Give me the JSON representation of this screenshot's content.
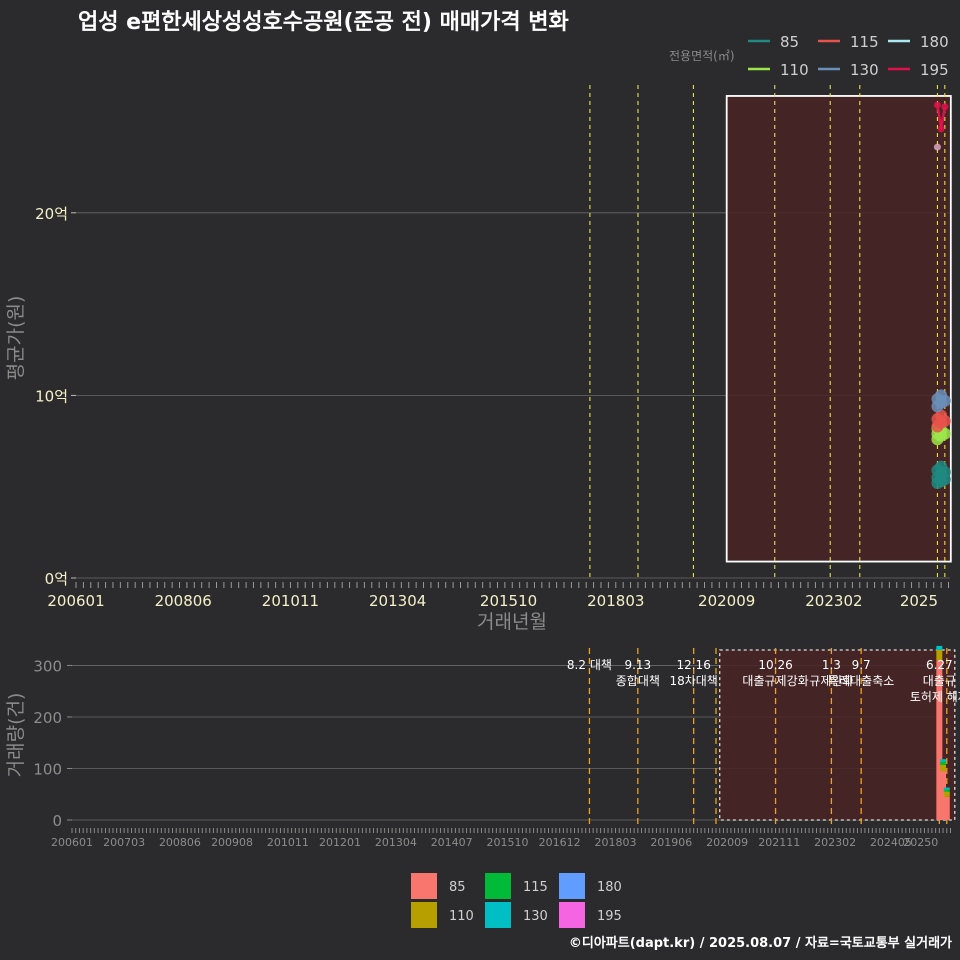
{
  "title": "업성 e편한세상성성호수공원(준공 전) 매매가격 변화",
  "footer": "©디아파트(dapt.kr) / 2025.08.07 / 자료=국토교통부 실거래가",
  "colors": {
    "background": "#2b2b2d",
    "grid": "#6a6a6a",
    "highlight_fill": "#4a2325",
    "policy_line_top": "#e8e04a",
    "policy_line_bottom": "#f0a020"
  },
  "chart_data": [
    {
      "type": "scatter",
      "title": "업성 e편한세상성성호수공원(준공 전) 매매가격 변화",
      "xlabel": "거래년월",
      "ylabel": "평균가(원)",
      "ylim": [
        0,
        27
      ],
      "y_ticks": [
        0,
        10,
        20
      ],
      "y_tick_labels": [
        "0억",
        "10억",
        "20억"
      ],
      "x_ticks": [
        "200601",
        "200806",
        "201011",
        "201304",
        "201510",
        "201803",
        "202009",
        "202302",
        "2025"
      ],
      "grid": true,
      "legend_title": "전용면적(㎡)",
      "legend_position": "top-right",
      "legend": [
        {
          "name": "85",
          "color": "#1f8a80"
        },
        {
          "name": "110",
          "color": "#9ce64a"
        },
        {
          "name": "115",
          "color": "#e8524a"
        },
        {
          "name": "130",
          "color": "#6a8fb8"
        },
        {
          "name": "180",
          "color": "#a8eaf0"
        },
        {
          "name": "195",
          "color": "#e0104a"
        }
      ],
      "policy_dates": [
        "2017-08",
        "2018-09",
        "2019-12",
        "2021-10",
        "2023-01",
        "2023-09",
        "2025-06",
        "2025-08"
      ],
      "highlight_range": {
        "x": [
          "2020-09",
          "2025-08"
        ],
        "y": [
          0.9,
          26.4
        ]
      },
      "series": [
        {
          "name": "85",
          "points": [
            [
              "2025-06",
              5.2
            ],
            [
              "2025-06",
              5.5
            ],
            [
              "2025-06",
              5.9
            ],
            [
              "2025-07",
              5.3
            ],
            [
              "2025-07",
              5.7
            ],
            [
              "2025-07",
              6.1
            ],
            [
              "2025-08",
              5.4
            ],
            [
              "2025-08",
              5.8
            ]
          ]
        },
        {
          "name": "110",
          "points": [
            [
              "2025-06",
              7.6
            ],
            [
              "2025-06",
              7.9
            ],
            [
              "2025-06",
              8.2
            ],
            [
              "2025-07",
              7.8
            ],
            [
              "2025-07",
              8.1
            ],
            [
              "2025-08",
              7.9
            ]
          ]
        },
        {
          "name": "115",
          "points": [
            [
              "2025-06",
              8.3
            ],
            [
              "2025-06",
              8.7
            ],
            [
              "2025-07",
              8.5
            ],
            [
              "2025-07",
              8.9
            ],
            [
              "2025-08",
              8.6
            ]
          ]
        },
        {
          "name": "130",
          "points": [
            [
              "2025-06",
              9.4
            ],
            [
              "2025-06",
              9.8
            ],
            [
              "2025-07",
              9.6
            ],
            [
              "2025-07",
              10.0
            ],
            [
              "2025-08",
              9.7
            ]
          ]
        },
        {
          "name": "195",
          "points": [
            [
              "2025-06",
              25.9
            ],
            [
              "2025-07",
              24.6
            ],
            [
              "2025-08",
              25.8
            ]
          ]
        },
        {
          "name": "180",
          "points": [
            [
              "2025-06",
              23.6
            ]
          ]
        }
      ]
    },
    {
      "type": "bar",
      "ylabel": "거래량(건)",
      "ylim": [
        0,
        330
      ],
      "y_ticks": [
        0,
        100,
        200,
        300
      ],
      "x_ticks": [
        "200601",
        "200703",
        "200806",
        "200908",
        "201011",
        "201201",
        "201304",
        "201407",
        "201510",
        "201612",
        "201803",
        "201906",
        "202009",
        "202111",
        "202302",
        "202405",
        "20250"
      ],
      "grid": true,
      "legend_position": "bottom",
      "legend": [
        {
          "name": "85",
          "color": "#f8766d"
        },
        {
          "name": "110",
          "color": "#b79f00"
        },
        {
          "name": "115",
          "color": "#00ba38"
        },
        {
          "name": "130",
          "color": "#00bfc4"
        },
        {
          "name": "180",
          "color": "#619cff"
        },
        {
          "name": "195",
          "color": "#f564e3"
        }
      ],
      "highlight_range": {
        "x": [
          "2020-07",
          "2025-08"
        ],
        "y": [
          0,
          330
        ]
      },
      "policy_dates": [
        "2017-08",
        "2018-09",
        "2019-12",
        "2020-06",
        "2021-10",
        "2023-01",
        "2023-09",
        "2025-06",
        "2025-08"
      ],
      "annotations": [
        {
          "date": "2017-08",
          "lines": [
            "8.2 대책"
          ]
        },
        {
          "date": "2018-09",
          "lines": [
            "9.13",
            "종합대책"
          ]
        },
        {
          "date": "2019-12",
          "lines": [
            "12.16",
            "18차대책"
          ]
        },
        {
          "date": "2021-10",
          "lines": [
            "10.26",
            "대출규제강화"
          ]
        },
        {
          "date": "2023-01",
          "lines": [
            "1.3",
            "규제완화"
          ]
        },
        {
          "date": "2023-09",
          "lines": [
            "9.7",
            "특례대출축소"
          ]
        },
        {
          "date": "2025-06",
          "lines": [
            "6.27",
            "대출규",
            "토허제 해제"
          ]
        }
      ],
      "bars": [
        {
          "date": "2025-06",
          "stack": [
            {
              "name": "85",
              "value": 310
            },
            {
              "name": "110",
              "value": 20
            },
            {
              "name": "130",
              "value": 8
            }
          ]
        },
        {
          "date": "2025-07",
          "stack": [
            {
              "name": "85",
              "value": 95
            },
            {
              "name": "110",
              "value": 12
            },
            {
              "name": "115",
              "value": 6
            },
            {
              "name": "130",
              "value": 5
            }
          ]
        },
        {
          "date": "2025-08",
          "stack": [
            {
              "name": "85",
              "value": 45
            },
            {
              "name": "110",
              "value": 10
            },
            {
              "name": "115",
              "value": 4
            },
            {
              "name": "130",
              "value": 4
            }
          ]
        }
      ]
    }
  ]
}
